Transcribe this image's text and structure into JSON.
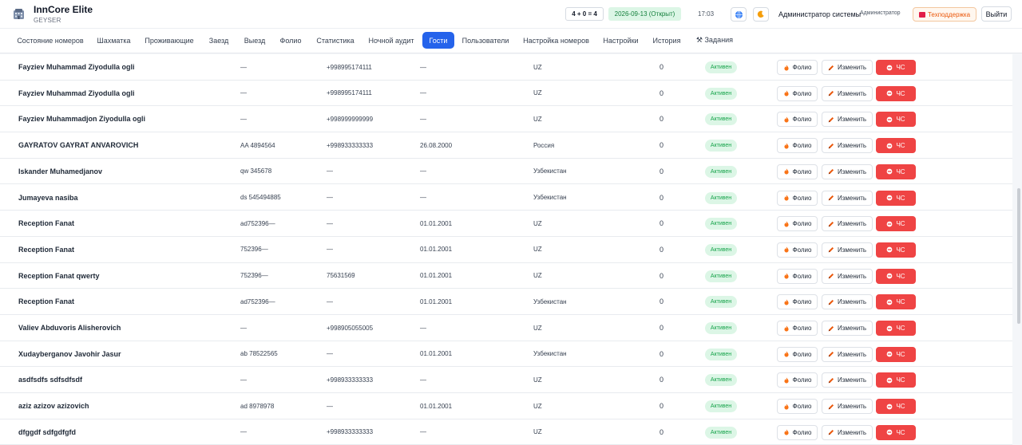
{
  "app": {
    "name": "InnCore Elite",
    "hotel": "GEYSER"
  },
  "header": {
    "count_formula": "4 + 0 = 4",
    "business_date": "2026-09-13 (Открыт)",
    "time": "17:03",
    "globe_icon": "globe-icon",
    "theme_icon": "moon-icon",
    "user_name": "Администратор системы",
    "user_role": "Администратор",
    "support_label": "Техподдержка",
    "logout_label": "Выйти"
  },
  "nav": {
    "tabs": [
      {
        "label": "Состояние номеров"
      },
      {
        "label": "Шахматка"
      },
      {
        "label": "Проживающие"
      },
      {
        "label": "Заезд"
      },
      {
        "label": "Выезд"
      },
      {
        "label": "Фолио"
      },
      {
        "label": "Статистика"
      },
      {
        "label": "Ночной аудит"
      },
      {
        "label": "Гости",
        "active": true
      },
      {
        "label": "Пользователи"
      },
      {
        "label": "Настройка номеров"
      },
      {
        "label": "Настройки"
      },
      {
        "label": "История"
      },
      {
        "label": "⚒ Задания"
      }
    ]
  },
  "actions": {
    "folio_label": "Фолио",
    "edit_label": "Изменить",
    "blacklist_label": "ЧС"
  },
  "guests": [
    {
      "name": "Fayziev Muhammad Ziyodulla ogli",
      "document": "—",
      "phone": "+998995174111",
      "birth": "—",
      "country": "UZ",
      "balance": "0",
      "status": "Активен"
    },
    {
      "name": "Fayziev Muhammad Ziyodulla ogli",
      "document": "—",
      "phone": "+998995174111",
      "birth": "—",
      "country": "UZ",
      "balance": "0",
      "status": "Активен"
    },
    {
      "name": "Fayziev Muhammadjon Ziyodulla ogli",
      "document": "—",
      "phone": "+998999999999",
      "birth": "—",
      "country": "UZ",
      "balance": "0",
      "status": "Активен"
    },
    {
      "name": "GAYRATOV GAYRAT ANVAROVICH",
      "document": "AA 4894564",
      "phone": "+998933333333",
      "birth": "26.08.2000",
      "country": "Россия",
      "balance": "0",
      "status": "Активен"
    },
    {
      "name": "Iskander Muhamedjanov",
      "document": "qw 345678",
      "phone": "—",
      "birth": "—",
      "country": "Узбекистан",
      "balance": "0",
      "status": "Активен"
    },
    {
      "name": "Jumayeva nasiba",
      "document": "ds 545494885",
      "phone": "—",
      "birth": "—",
      "country": "Узбекистан",
      "balance": "0",
      "status": "Активен"
    },
    {
      "name": "Reception Fanat",
      "document": "ad752396—",
      "phone": "—",
      "birth": "01.01.2001",
      "country": "UZ",
      "balance": "0",
      "status": "Активен"
    },
    {
      "name": "Reception Fanat",
      "document": "752396—",
      "phone": "—",
      "birth": "01.01.2001",
      "country": "UZ",
      "balance": "0",
      "status": "Активен"
    },
    {
      "name": "Reception Fanat qwerty",
      "document": "752396—",
      "phone": "75631569",
      "birth": "01.01.2001",
      "country": "UZ",
      "balance": "0",
      "status": "Активен"
    },
    {
      "name": "Reception Fanat",
      "document": "ad752396—",
      "phone": "—",
      "birth": "01.01.2001",
      "country": "Узбекистан",
      "balance": "0",
      "status": "Активен"
    },
    {
      "name": "Valiev Abduvoris Alisherovich",
      "document": "—",
      "phone": "+998905055005",
      "birth": "—",
      "country": "UZ",
      "balance": "0",
      "status": "Активен"
    },
    {
      "name": "Xudayberganov Javohir Jasur",
      "document": "ab 78522565",
      "phone": "—",
      "birth": "01.01.2001",
      "country": "Узбекистан",
      "balance": "0",
      "status": "Активен"
    },
    {
      "name": "asdfsdfs sdfsdfsdf",
      "document": "—",
      "phone": "+998933333333",
      "birth": "—",
      "country": "UZ",
      "balance": "0",
      "status": "Активен"
    },
    {
      "name": "aziz azizov azizovich",
      "document": "ad 8978978",
      "phone": "—",
      "birth": "01.01.2001",
      "country": "UZ",
      "balance": "0",
      "status": "Активен"
    },
    {
      "name": "dfggdf sdfgdfgfd",
      "document": "—",
      "phone": "+998933333333",
      "birth": "—",
      "country": "UZ",
      "balance": "0",
      "status": "Активен"
    }
  ],
  "colors": {
    "accent": "#2563eb",
    "danger": "#ef4444",
    "success_bg": "#dcf6e6",
    "success_text": "#16a34a",
    "support": "#ea580c"
  }
}
